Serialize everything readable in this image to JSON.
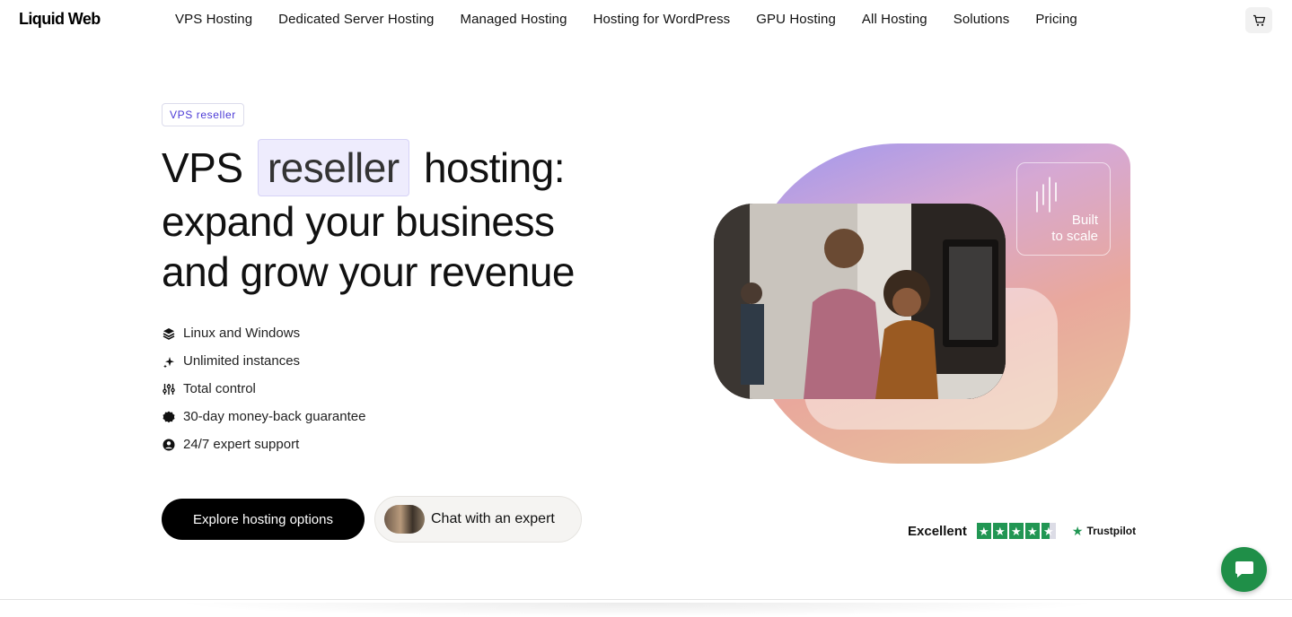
{
  "header": {
    "logo": "Liquid Web",
    "nav": [
      "VPS Hosting",
      "Dedicated Server Hosting",
      "Managed Hosting",
      "Hosting for WordPress",
      "GPU Hosting",
      "All Hosting",
      "Solutions",
      "Pricing"
    ],
    "cart_icon": "cart-icon"
  },
  "hero": {
    "badge": "VPS reseller",
    "headline": {
      "part1": "VPS",
      "highlight": "reseller",
      "part2": "hosting:",
      "line2": "expand your business",
      "line3": "and grow your revenue"
    },
    "features": [
      {
        "icon": "layers-icon",
        "label": "Linux and Windows"
      },
      {
        "icon": "sparkle-icon",
        "label": "Unlimited instances"
      },
      {
        "icon": "sliders-icon",
        "label": "Total control"
      },
      {
        "icon": "badge-icon",
        "label": "30-day money-back guarantee"
      },
      {
        "icon": "user-circle-icon",
        "label": "24/7 expert support"
      }
    ],
    "primary_button": "Explore hosting options",
    "chat_button": "Chat with an expert"
  },
  "visual": {
    "panel_text_line1": "Built",
    "panel_text_line2": "to scale"
  },
  "trustpilot": {
    "rating_word": "Excellent",
    "stars": 4.5,
    "brand": "Trustpilot"
  },
  "colors": {
    "accent_purple": "#4b3ad6",
    "highlight_bg": "#eeecfd",
    "trust_green": "#219653",
    "chat_green": "#1f8f48"
  }
}
